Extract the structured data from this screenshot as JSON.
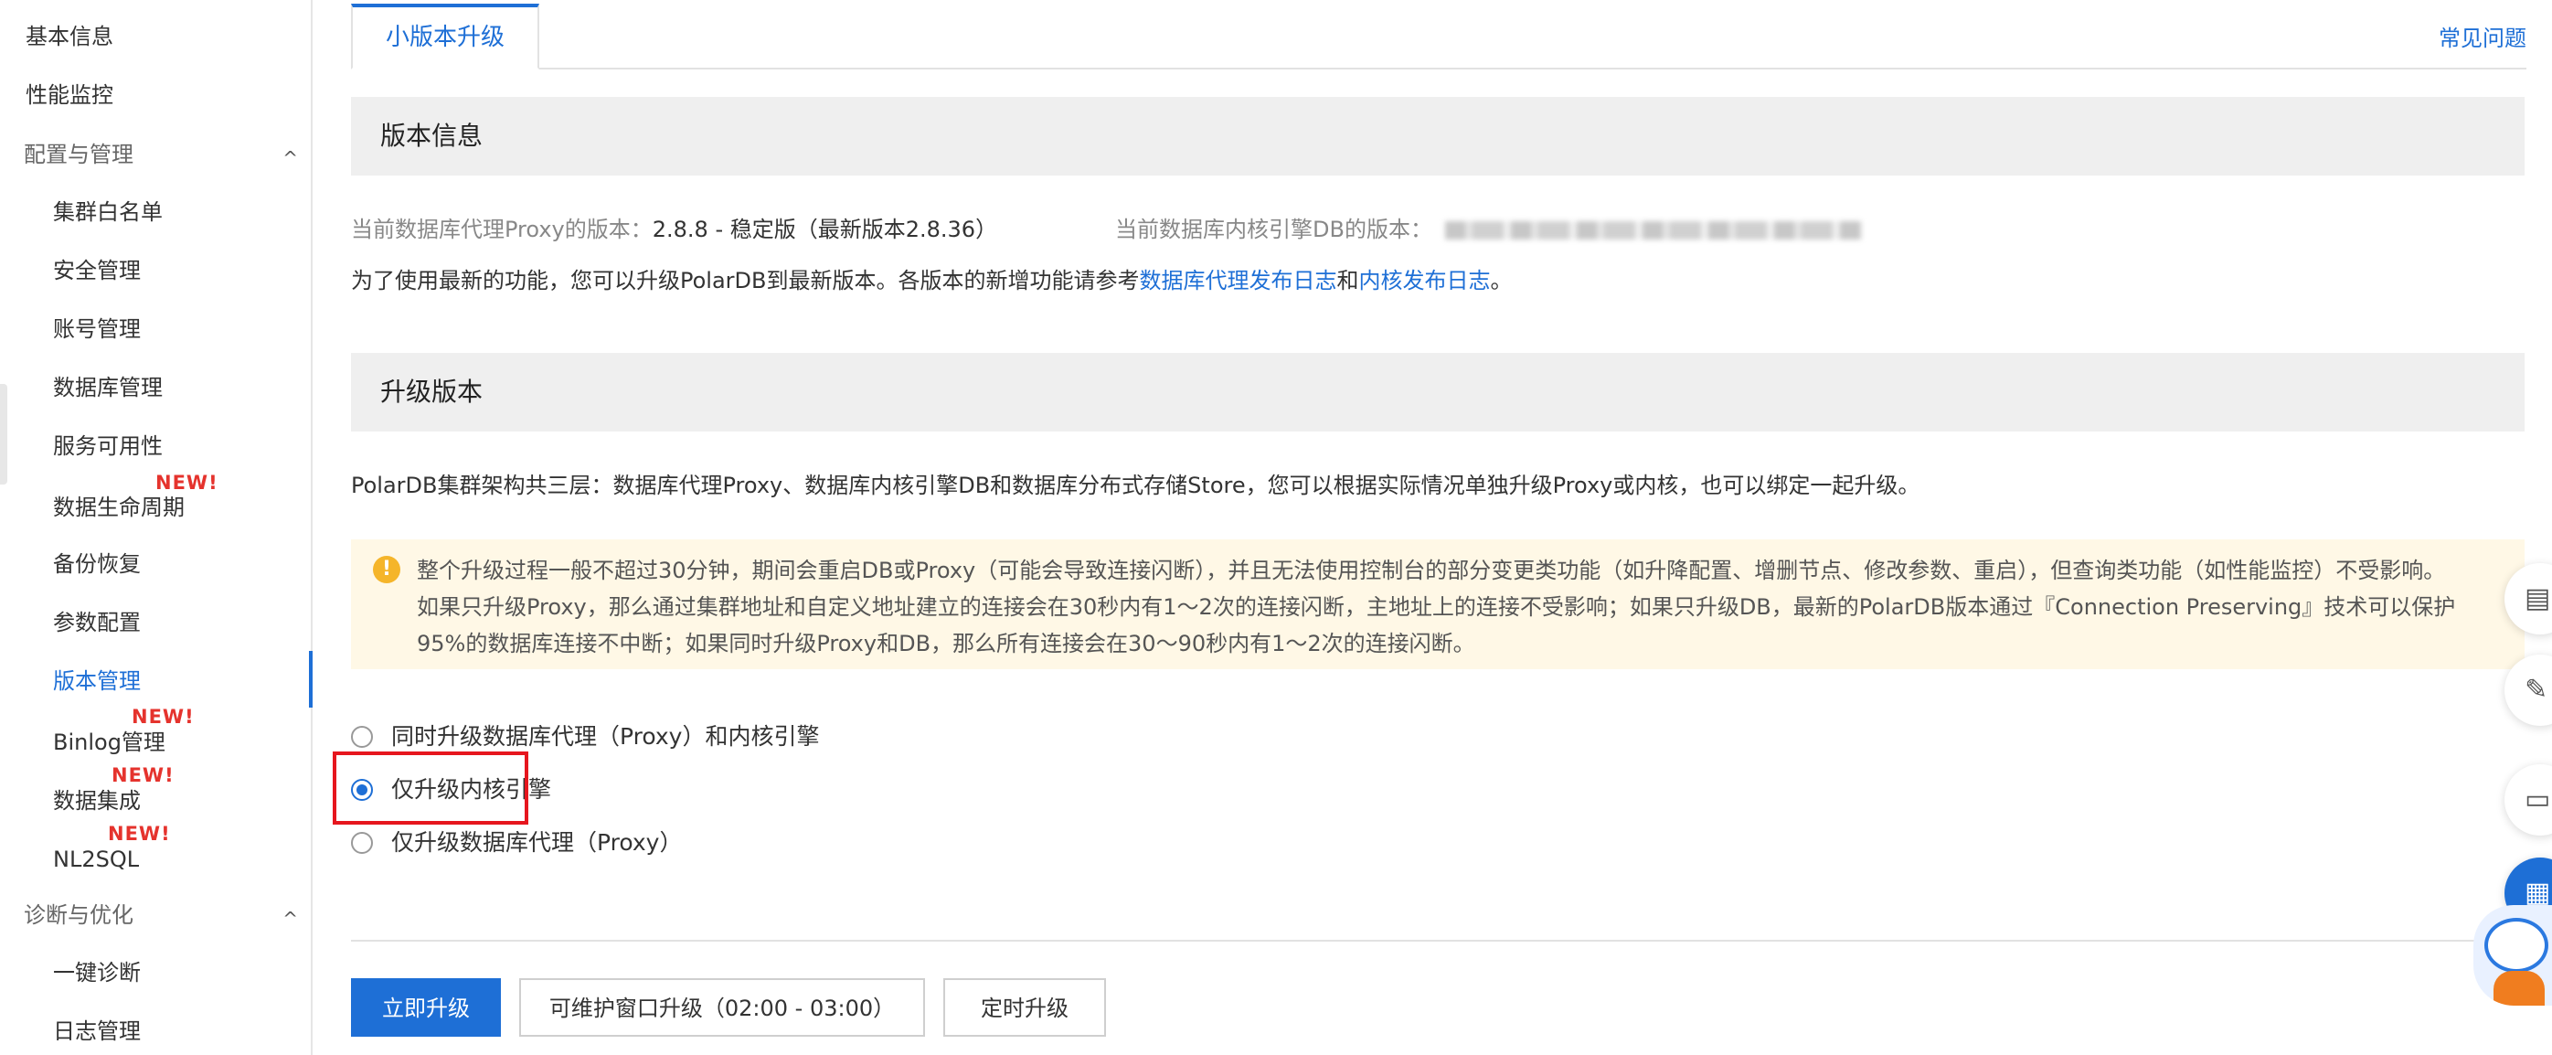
{
  "sidebar": {
    "items": [
      {
        "label": "基本信息"
      },
      {
        "label": "性能监控"
      },
      {
        "label": "配置与管理",
        "group": true
      },
      {
        "label": "集群白名单"
      },
      {
        "label": "安全管理"
      },
      {
        "label": "账号管理"
      },
      {
        "label": "数据库管理"
      },
      {
        "label": "服务可用性"
      },
      {
        "label": "数据生命周期",
        "badge": "NEW!"
      },
      {
        "label": "备份恢复"
      },
      {
        "label": "参数配置"
      },
      {
        "label": "版本管理",
        "active": true
      },
      {
        "label": "Binlog管理",
        "badge": "NEW!"
      },
      {
        "label": "数据集成",
        "badge": "NEW!"
      },
      {
        "label": "NL2SQL",
        "badge": "NEW!"
      },
      {
        "label": "诊断与优化",
        "group": true
      },
      {
        "label": "一键诊断"
      },
      {
        "label": "日志管理"
      }
    ],
    "chevron": "^",
    "colors": {
      "active": "#1e6fd6",
      "badge": "#e5332d"
    }
  },
  "tabs": {
    "active_label": "小版本升级",
    "faq": "常见问题"
  },
  "version_info": {
    "title": "版本信息",
    "proxy_label": "当前数据库代理Proxy的版本：",
    "proxy_value": "2.8.8 - 稳定版（最新版本2.8.36）",
    "db_label": "当前数据库内核引擎DB的版本：",
    "desc_prefix": "为了使用最新的功能，您可以升级PolarDB到最新版本。各版本的新增功能请参考",
    "link_proxy": "数据库代理发布日志",
    "desc_and": "和",
    "link_kernel": "内核发布日志",
    "desc_suffix": "。"
  },
  "upgrade": {
    "title": "升级版本",
    "desc": "PolarDB集群架构共三层：数据库代理Proxy、数据库内核引擎DB和数据库分布式存储Store，您可以根据实际情况单独升级Proxy或内核，也可以绑定一起升级。",
    "warning_icon": "!",
    "warning_lines": [
      "整个升级过程一般不超过30分钟，期间会重启DB或Proxy（可能会导致连接闪断），并且无法使用控制台的部分变更类功能（如升降配置、增删节点、修改参数、重启），但查询类功能（如性能监控）不受影响。",
      "如果只升级Proxy，那么通过集群地址和自定义地址建立的连接会在30秒内有1～2次的连接闪断，主地址上的连接不受影响；如果只升级DB，最新的PolarDB版本通过『Connection Preserving』技术可以保护",
      "95%的数据库连接不中断；如果同时升级Proxy和DB，那么所有连接会在30～90秒内有1～2次的连接闪断。"
    ],
    "options": [
      {
        "label": "同时升级数据库代理（Proxy）和内核引擎",
        "checked": false
      },
      {
        "label": "仅升级内核引擎",
        "checked": true
      },
      {
        "label": "仅升级数据库代理（Proxy）",
        "checked": false
      }
    ]
  },
  "buttons": {
    "upgrade_now": "立即升级",
    "maintenance": "可维护窗口升级（02:00 - 03:00）",
    "scheduled": "定时升级"
  },
  "floating": {
    "icons": [
      "clipboard-icon",
      "edit-icon",
      "chat-icon",
      "grid-icon",
      "assistant-avatar"
    ]
  }
}
